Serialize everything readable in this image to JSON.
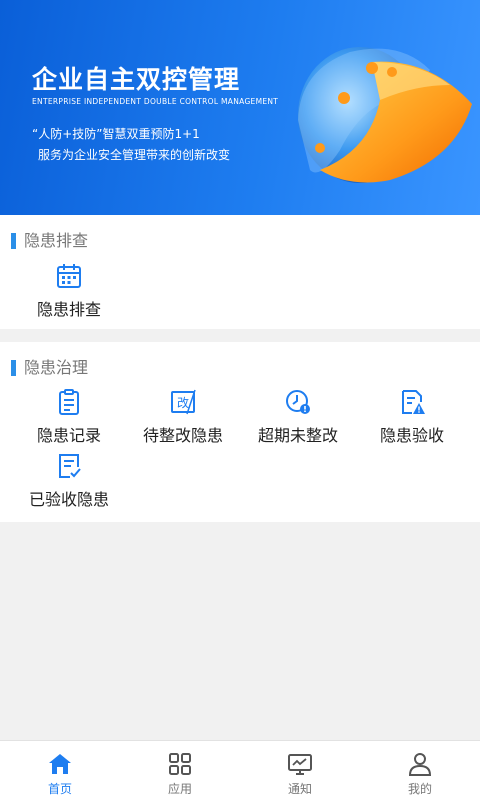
{
  "banner": {
    "title": "企业自主双控管理",
    "subtitle": "ENTERPRISE INDEPENDENT DOUBLE CONTROL MANAGEMENT",
    "line1": "“人防+技防”智慧双重预防1+1",
    "line2": "服务为企业安全管理带来的创新改变"
  },
  "sections": {
    "inspection": {
      "title": "隐患排查",
      "items": [
        {
          "label": "隐患排查",
          "icon": "calendar-icon"
        }
      ]
    },
    "governance": {
      "title": "隐患治理",
      "items": [
        {
          "label": "隐患记录",
          "icon": "clipboard-icon"
        },
        {
          "label": "待整改隐患",
          "icon": "edit-doc-icon"
        },
        {
          "label": "超期未整改",
          "icon": "clock-alert-icon"
        },
        {
          "label": "隐患验收",
          "icon": "doc-warning-icon"
        },
        {
          "label": "已验收隐患",
          "icon": "doc-check-icon"
        }
      ]
    }
  },
  "tabbar": {
    "items": [
      {
        "label": "首页",
        "icon": "home-icon",
        "active": true
      },
      {
        "label": "应用",
        "icon": "apps-grid-icon",
        "active": false
      },
      {
        "label": "通知",
        "icon": "monitor-icon",
        "active": false
      },
      {
        "label": "我的",
        "icon": "user-icon",
        "active": false
      }
    ]
  },
  "colors": {
    "accent": "#1e7df0",
    "banner_start": "#0a5fd8",
    "banner_end": "#3a95ff",
    "background": "#f1f1f1"
  }
}
